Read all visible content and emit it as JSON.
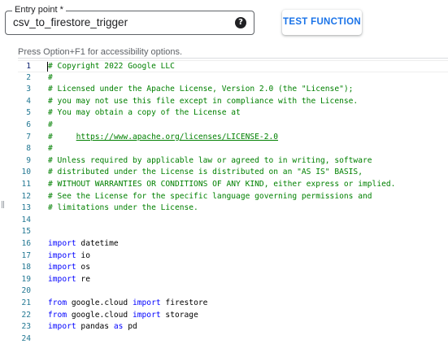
{
  "entry_point": {
    "label": "Entry point *",
    "value": "csv_to_firestore_trigger",
    "help_icon": "question-circle-icon",
    "help_glyph": "?"
  },
  "test_button": {
    "label": "TEST FUNCTION"
  },
  "accessibility_note": "Press Option+F1 for accessibility options.",
  "editor": {
    "current_line": 1,
    "lines": [
      {
        "n": "1",
        "tokens": [
          {
            "t": "# Copyright 2022 Google LLC",
            "c": "cm"
          }
        ]
      },
      {
        "n": "2",
        "tokens": [
          {
            "t": "#",
            "c": "cm"
          }
        ]
      },
      {
        "n": "3",
        "tokens": [
          {
            "t": "# Licensed under the Apache License, Version 2.0 (the \"License\");",
            "c": "cm"
          }
        ]
      },
      {
        "n": "4",
        "tokens": [
          {
            "t": "# you may not use this file except in compliance with the License.",
            "c": "cm"
          }
        ]
      },
      {
        "n": "5",
        "tokens": [
          {
            "t": "# You may obtain a copy of the License at",
            "c": "cm"
          }
        ]
      },
      {
        "n": "6",
        "tokens": [
          {
            "t": "#",
            "c": "cm"
          }
        ]
      },
      {
        "n": "7",
        "tokens": [
          {
            "t": "#     ",
            "c": "cm"
          },
          {
            "t": "https://www.apache.org/licenses/LICENSE-2.0",
            "c": "cm url"
          }
        ]
      },
      {
        "n": "8",
        "tokens": [
          {
            "t": "#",
            "c": "cm"
          }
        ]
      },
      {
        "n": "9",
        "tokens": [
          {
            "t": "# Unless required by applicable law or agreed to in writing, software",
            "c": "cm"
          }
        ]
      },
      {
        "n": "10",
        "tokens": [
          {
            "t": "# distributed under the License is distributed on an \"AS IS\" BASIS,",
            "c": "cm"
          }
        ]
      },
      {
        "n": "11",
        "tokens": [
          {
            "t": "# WITHOUT WARRANTIES OR CONDITIONS OF ANY KIND, either express or implied.",
            "c": "cm"
          }
        ]
      },
      {
        "n": "12",
        "tokens": [
          {
            "t": "# See the License for the specific language governing permissions and",
            "c": "cm"
          }
        ]
      },
      {
        "n": "13",
        "tokens": [
          {
            "t": "# limitations under the License.",
            "c": "cm"
          }
        ]
      },
      {
        "n": "14",
        "tokens": []
      },
      {
        "n": "15",
        "tokens": []
      },
      {
        "n": "16",
        "tokens": [
          {
            "t": "import",
            "c": "kw"
          },
          {
            "t": " datetime",
            "c": "id"
          }
        ]
      },
      {
        "n": "17",
        "tokens": [
          {
            "t": "import",
            "c": "kw"
          },
          {
            "t": " io",
            "c": "id"
          }
        ]
      },
      {
        "n": "18",
        "tokens": [
          {
            "t": "import",
            "c": "kw"
          },
          {
            "t": " os",
            "c": "id"
          }
        ]
      },
      {
        "n": "19",
        "tokens": [
          {
            "t": "import",
            "c": "kw"
          },
          {
            "t": " re",
            "c": "id"
          }
        ]
      },
      {
        "n": "20",
        "tokens": []
      },
      {
        "n": "21",
        "tokens": [
          {
            "t": "from",
            "c": "kw"
          },
          {
            "t": " google.cloud ",
            "c": "id"
          },
          {
            "t": "import",
            "c": "kw"
          },
          {
            "t": " firestore",
            "c": "id"
          }
        ]
      },
      {
        "n": "22",
        "tokens": [
          {
            "t": "from",
            "c": "kw"
          },
          {
            "t": " google.cloud ",
            "c": "id"
          },
          {
            "t": "import",
            "c": "kw"
          },
          {
            "t": " storage",
            "c": "id"
          }
        ]
      },
      {
        "n": "23",
        "tokens": [
          {
            "t": "import",
            "c": "kw"
          },
          {
            "t": " pandas ",
            "c": "id"
          },
          {
            "t": "as",
            "c": "kw"
          },
          {
            "t": " pd",
            "c": "id"
          }
        ]
      },
      {
        "n": "24",
        "tokens": []
      }
    ]
  }
}
